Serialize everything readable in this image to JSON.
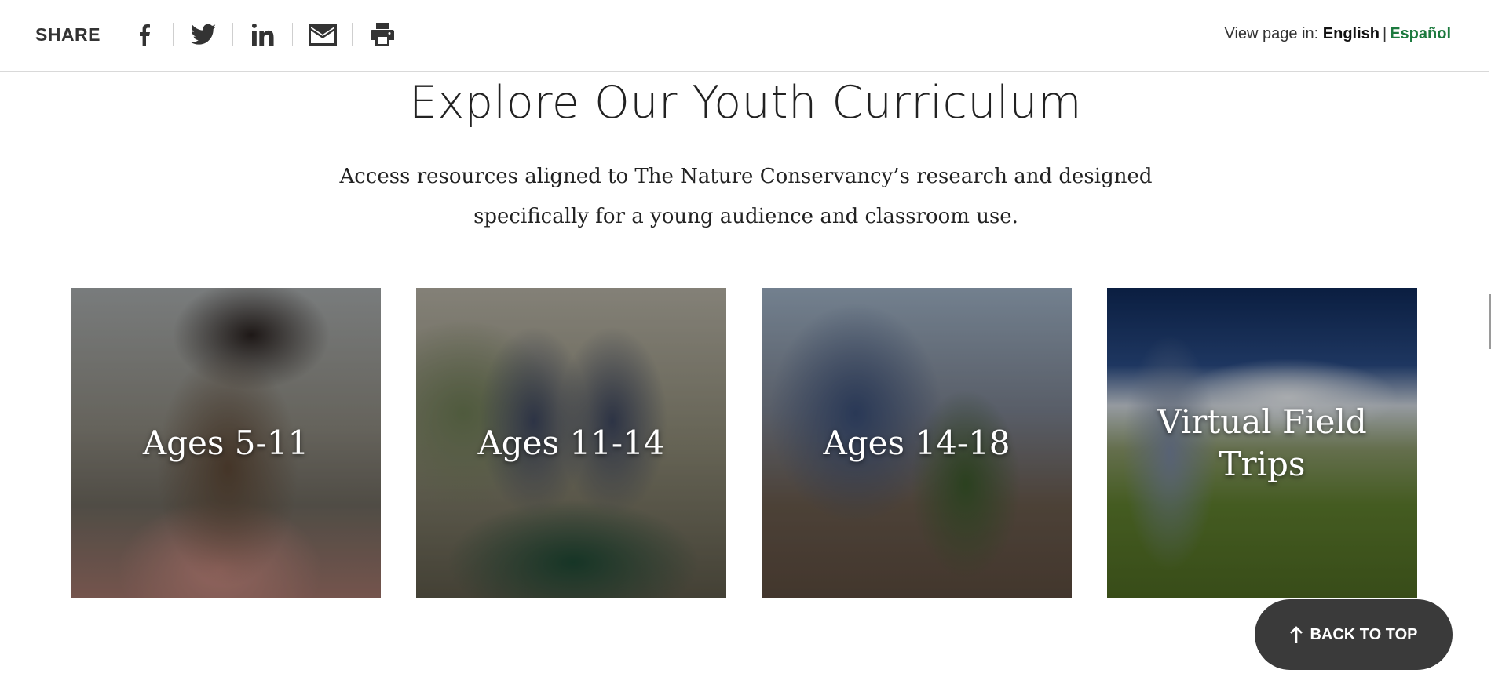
{
  "share": {
    "label": "SHARE",
    "icons": [
      "facebook-icon",
      "twitter-icon",
      "linkedin-icon",
      "email-icon",
      "print-icon"
    ]
  },
  "language": {
    "prefix": "View page in:",
    "current": "English",
    "separator": "|",
    "alternate": "Español"
  },
  "section": {
    "title": "Explore Our Youth Curriculum",
    "intro_line1": "Access resources aligned to The Nature Conservancy’s research and designed",
    "intro_line2": "specifically for a young audience and classroom use."
  },
  "cards": [
    {
      "label": "Ages 5-11"
    },
    {
      "label": "Ages 11-14"
    },
    {
      "label": "Ages 14-18"
    },
    {
      "label": "Virtual Field Trips"
    }
  ],
  "back_to_top": {
    "label": "BACK TO TOP",
    "icon": "arrow-up-icon"
  },
  "colors": {
    "accent_green": "#1c7a3e",
    "button_dark": "#3a3a3a"
  }
}
